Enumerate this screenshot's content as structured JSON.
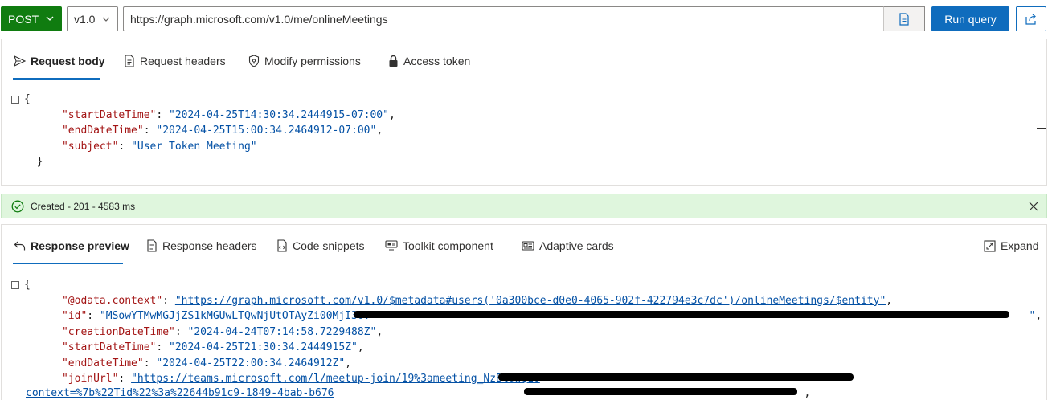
{
  "query_bar": {
    "method": "POST",
    "version": "v1.0",
    "url": "https://graph.microsoft.com/v1.0/me/onlineMeetings",
    "run_label": "Run query"
  },
  "request": {
    "tabs": [
      {
        "label": "Request body",
        "icon": "send-icon",
        "active": true
      },
      {
        "label": "Request headers",
        "icon": "document-icon",
        "active": false
      },
      {
        "label": "Modify permissions",
        "icon": "shield-icon",
        "active": false
      },
      {
        "label": "Access token",
        "icon": "lock-icon",
        "active": false
      }
    ],
    "body": {
      "open": "{",
      "close": "}",
      "fields": [
        {
          "key": "\"startDateTime\"",
          "value": "\"2024-04-25T14:30:34.2444915-07:00\"",
          "trail": ","
        },
        {
          "key": "\"endDateTime\"",
          "value": "\"2024-04-25T15:00:34.2464912-07:00\"",
          "trail": ","
        },
        {
          "key": "\"subject\"",
          "value": "\"User Token Meeting\"",
          "trail": ""
        }
      ]
    }
  },
  "status": {
    "text": "Created - 201 - 4583 ms",
    "color": "#dff6dd"
  },
  "response": {
    "tabs": [
      {
        "label": "Response preview",
        "icon": "undo-arrow-icon",
        "active": true
      },
      {
        "label": "Response headers",
        "icon": "document-icon",
        "active": false
      },
      {
        "label": "Code snippets",
        "icon": "code-snippet-icon",
        "active": false
      },
      {
        "label": "Toolkit component",
        "icon": "toolkit-icon",
        "active": false
      },
      {
        "label": "Adaptive cards",
        "icon": "card-icon",
        "active": false
      }
    ],
    "expand_label": "Expand",
    "body": {
      "open": "{",
      "context_key": "\"@odata.context\"",
      "context_value": "\"https://graph.microsoft.com/v1.0/$metadata#users('0a300bce-d0e0-4065-902f-422794e3c7dc')/onlineMeetings/$entity\"",
      "id_key": "\"id\"",
      "id_value_visible": "\"MSowYTMwMGJjZS1kMGUwLTQwNjUtOTAyZi00MjI3OT",
      "id_value_end": "\"",
      "creation_key": "\"creationDateTime\"",
      "creation_value": "\"2024-04-24T07:14:58.7229488Z\"",
      "start_key": "\"startDateTime\"",
      "start_value": "\"2024-04-25T21:30:34.2444915Z\"",
      "end_key": "\"endDateTime\"",
      "end_value": "\"2024-04-25T22:00:34.2464912Z\"",
      "join_key": "\"joinUrl\"",
      "join_value_visible": "\"https://teams.microsoft.com/l/meetup-join/19%3ameeting_NzBlOWQ1O",
      "join_value_line2": "context=%7b%22Tid%22%3a%22644b91c9-1849-4bab-b676"
    }
  }
}
